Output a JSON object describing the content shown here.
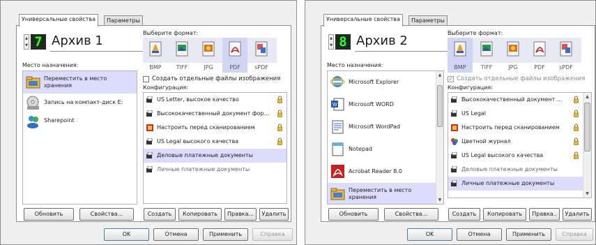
{
  "left": {
    "tabs": [
      "Универсальные свойства",
      "Параметры"
    ],
    "profile_digit": "7",
    "profile_name": "Архив 1",
    "destination_label": "Место назначения:",
    "destinations": [
      {
        "label": "Переместить в место хранения",
        "icon": "folder-icon",
        "selected": true
      },
      {
        "label": "Запись на компакт-диск  E:",
        "icon": "cd-drive-icon",
        "selected": false
      },
      {
        "label": "Sharepoint",
        "icon": "sharepoint-icon",
        "selected": false
      }
    ],
    "format_label": "Выберите формат:",
    "formats": [
      "BMP",
      "TIFF",
      "JPG",
      "PDF",
      "sPDF"
    ],
    "selected_format": "PDF",
    "separate_files_label": "Создать отдельные файлы изображения",
    "config_label": "Конфигурация:",
    "configs": [
      {
        "label": "US Letter, высокое качество",
        "icon": "scanner-icon",
        "locked": true,
        "selected": false
      },
      {
        "label": "Высококачественный документ фор...",
        "icon": "scanner-icon",
        "locked": true,
        "selected": false
      },
      {
        "label": "Настроить перед сканированием",
        "icon": "configure-icon",
        "locked": true,
        "selected": false
      },
      {
        "label": "US Legal высокого качества",
        "icon": "scanner-icon",
        "locked": true,
        "selected": false
      },
      {
        "label": "Деловые платежные документы",
        "icon": "scanner-icon",
        "locked": false,
        "selected": true
      },
      {
        "label": "Личные платежные документы",
        "icon": "scanner-icon",
        "locked": false,
        "selected": false
      }
    ],
    "buttons": {
      "refresh": "Обновить",
      "properties": "Свойства...",
      "create": "Создать",
      "copy": "Копировать",
      "edit": "Правка...",
      "delete": "Удалить"
    },
    "footer": {
      "ok": "OK",
      "cancel": "Отмена",
      "apply": "Применить",
      "help": "Справка"
    }
  },
  "right": {
    "tabs": [
      "Универсальные свойства",
      "Параметры"
    ],
    "profile_digit": "8",
    "profile_name": "Архив 2",
    "destination_label": "Место назначения:",
    "destinations": [
      {
        "label": "Microsoft Explorer",
        "icon": "internet-explorer-icon",
        "selected": false
      },
      {
        "label": "Microsoft WORD",
        "icon": "word-icon",
        "selected": false
      },
      {
        "label": "Microsoft WordPad",
        "icon": "wordpad-icon",
        "selected": false
      },
      {
        "label": "Notepad",
        "icon": "notepad-icon",
        "selected": false
      },
      {
        "label": "Acrobat Reader 8.0",
        "icon": "acrobat-icon",
        "selected": false
      },
      {
        "label": "Переместить в место хранения",
        "icon": "folder-icon",
        "selected": true
      }
    ],
    "format_label": "Выберите формат:",
    "formats": [
      "BMP",
      "TIFF",
      "JPG",
      "PDF",
      "sPDF"
    ],
    "selected_format": "BMP",
    "separate_files_label": "Создать отдельные файлы изображения",
    "separate_files_checked": true,
    "config_label": "Конфигурация:",
    "configs": [
      {
        "label": "Высококачественный документ ...",
        "icon": "scanner-icon",
        "locked": true,
        "selected": false
      },
      {
        "label": "US Legal",
        "icon": "scanner-icon",
        "locked": true,
        "selected": false
      },
      {
        "label": "Настроить перед сканированием",
        "icon": "configure-icon",
        "locked": true,
        "selected": false
      },
      {
        "label": "Цветной журнал",
        "icon": "color-magazine-icon",
        "locked": true,
        "selected": false
      },
      {
        "label": "US Legal высокого качества",
        "icon": "scanner-icon",
        "locked": true,
        "selected": false
      },
      {
        "label": "Деловые платежные документы",
        "icon": "scanner-icon",
        "locked": false,
        "selected": false
      },
      {
        "label": "Личные платежные документы",
        "icon": "scanner-icon",
        "locked": false,
        "selected": true
      }
    ],
    "buttons": {
      "refresh": "Обновить",
      "properties": "Свойства...",
      "create": "Создать",
      "copy": "Копировать",
      "edit": "Правка..",
      "delete": "Удалить"
    },
    "footer": {
      "ok": "OK",
      "cancel": "Отмена",
      "apply": "Применить",
      "help": "Справка"
    }
  }
}
